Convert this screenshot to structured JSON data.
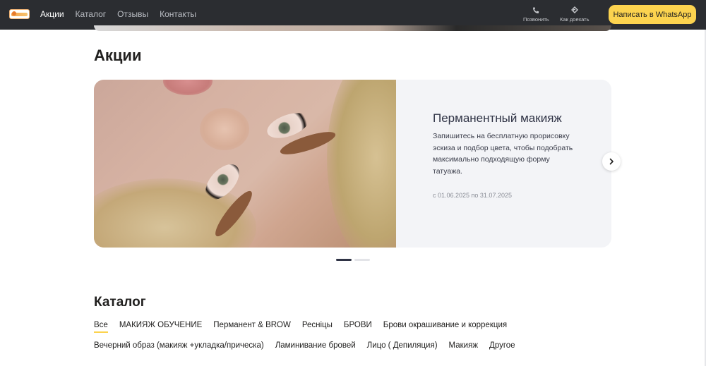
{
  "header": {
    "nav": [
      "Акции",
      "Каталог",
      "Отзывы",
      "Контакты"
    ],
    "active_nav": "Акции",
    "call_label": "Позвонить",
    "route_label": "Как доехать",
    "whatsapp_label": "Написать в WhatsApp"
  },
  "promo": {
    "heading": "Акции",
    "slide": {
      "title": "Перманентный макияж",
      "text": "Запишитесь на бесплатную прорисовку эскиза и подбор цвета, чтобы подобрать максимально подходящую форму татуажа.",
      "date": "с 01.06.2025 по 31.07.2025"
    },
    "slides_total": 2,
    "slide_current": 1
  },
  "catalog": {
    "heading": "Каталог",
    "categories_row1": [
      "Все",
      "МАКИЯЖ ОБУЧЕНИЕ",
      "Перманент & BROW",
      "Реснiцы",
      "БРОВИ",
      "Брови окрашивание и коррекция"
    ],
    "categories_row2": [
      "Вечерний образ (макияж +укладка/прическа)",
      "Ламинивание бровей",
      "Лицо ( Депиляция)",
      "Макияж",
      "Другое"
    ],
    "active_category": "Все"
  },
  "colors": {
    "header_bg": "#2b2d31",
    "accent_yellow": "#fcd34f",
    "slide_bg": "#f3f4f7",
    "title_dark": "#2f3345"
  },
  "icons": {
    "call": "phone-icon",
    "route": "route-icon",
    "next": "chevron-right-icon"
  }
}
